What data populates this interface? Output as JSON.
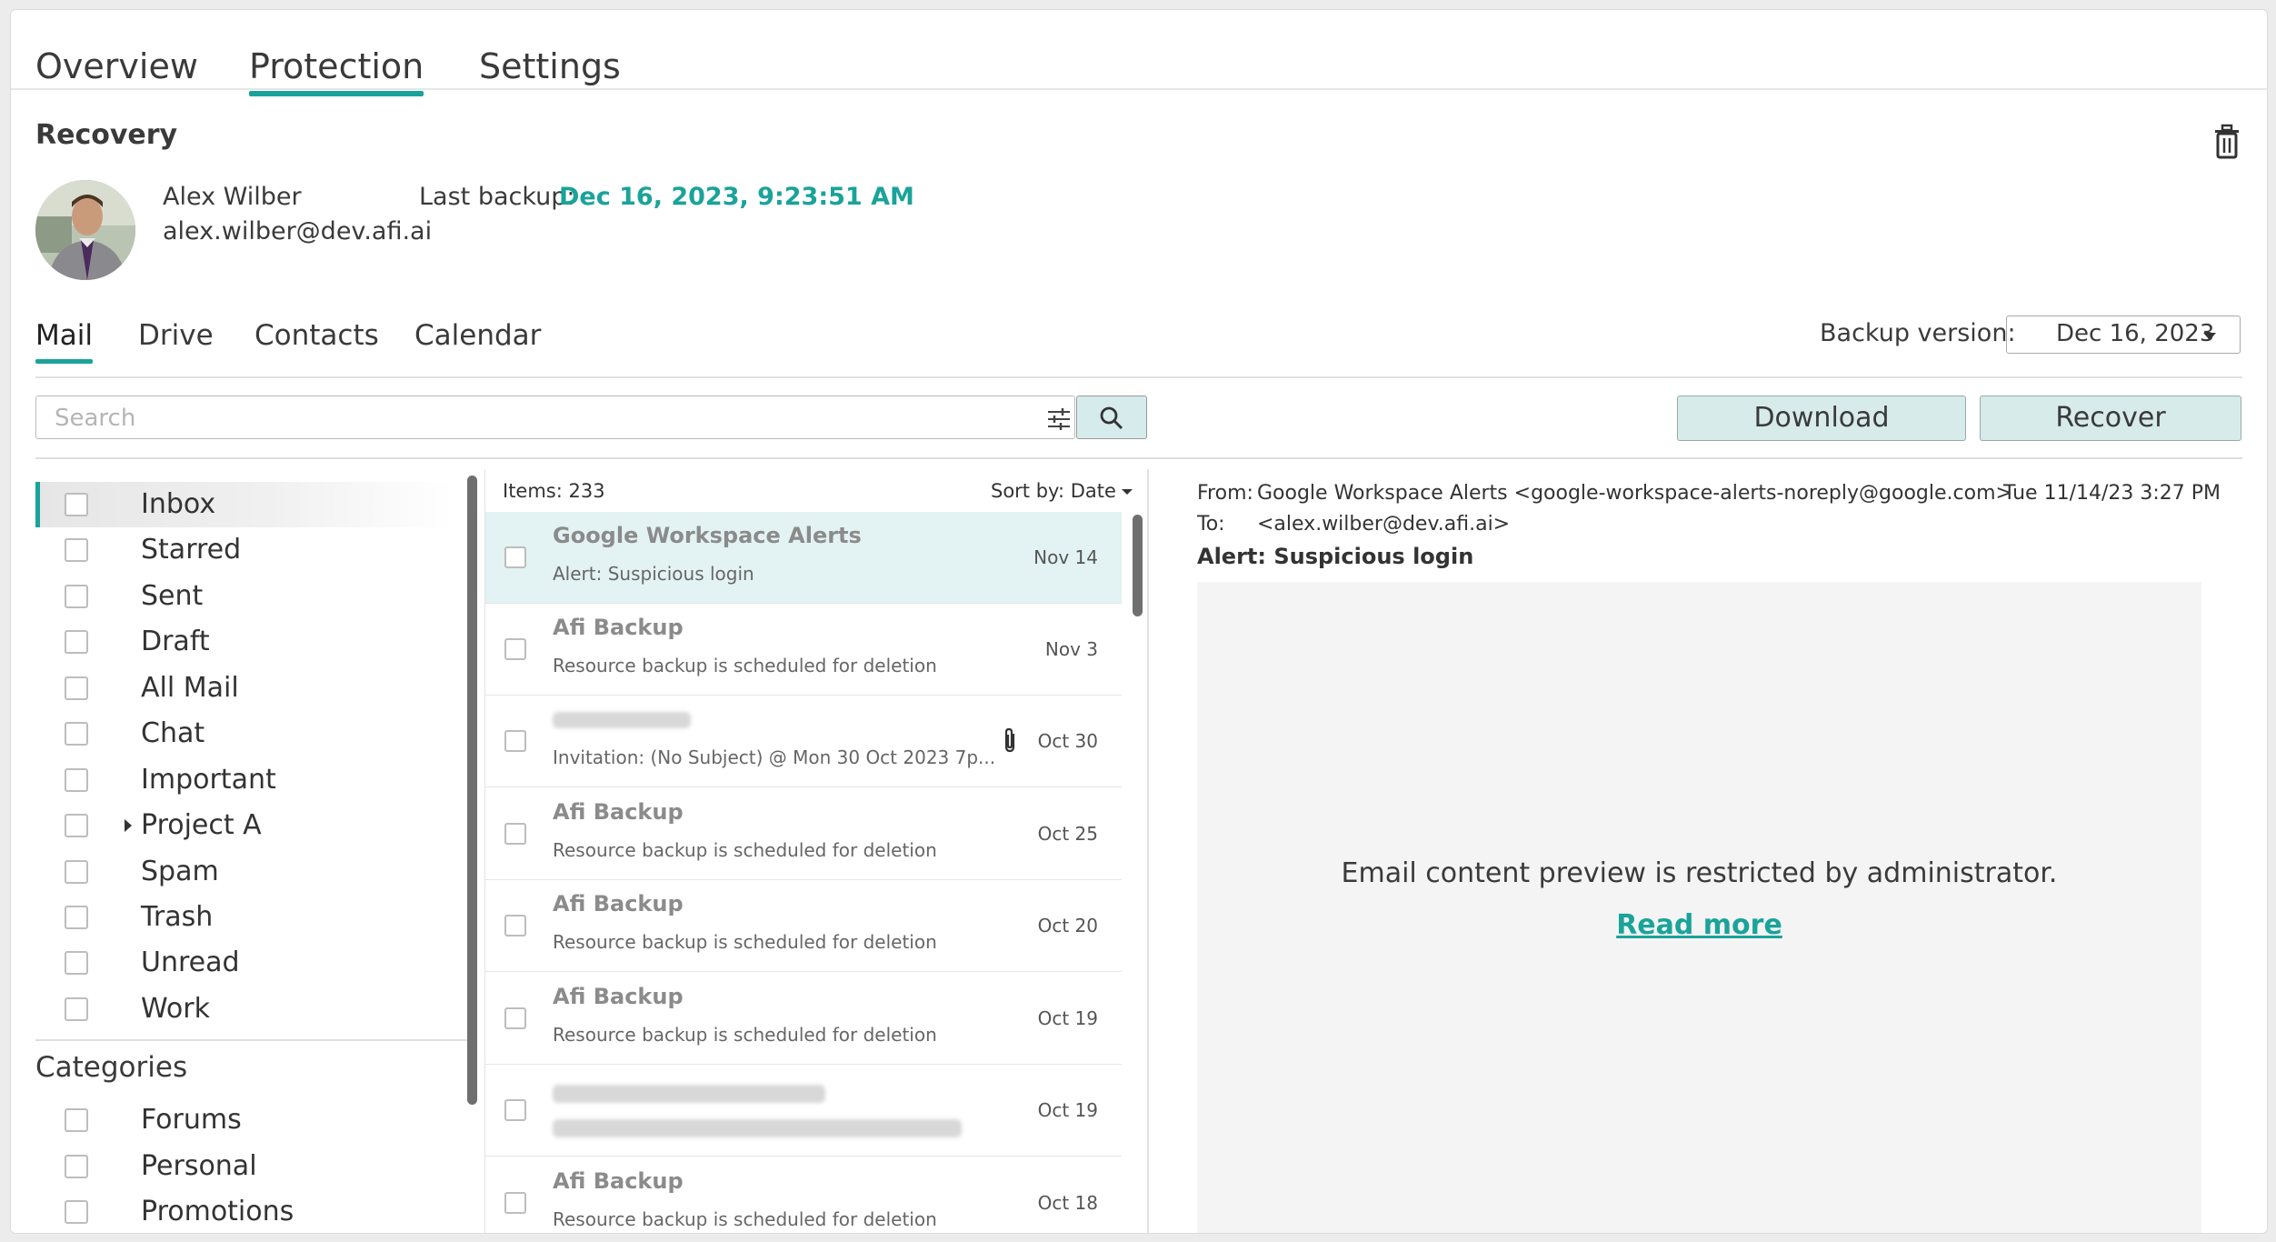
{
  "top_tabs": [
    "Overview",
    "Protection",
    "Settings"
  ],
  "section_title": "Recovery",
  "user": {
    "name": "Alex Wilber",
    "email": "alex.wilber@dev.afi.ai"
  },
  "last_backup": {
    "label": "Last backup:",
    "value": "Dec 16, 2023, 9:23:51 AM"
  },
  "sub_tabs": [
    "Mail",
    "Drive",
    "Contacts",
    "Calendar"
  ],
  "backup_version": {
    "label": "Backup version:",
    "value": "Dec 16, 2023"
  },
  "search": {
    "placeholder": "Search"
  },
  "actions": {
    "download": "Download",
    "recover": "Recover"
  },
  "folders": [
    "Inbox",
    "Starred",
    "Sent",
    "Draft",
    "All Mail",
    "Chat",
    "Important",
    "Project A",
    "Spam",
    "Trash",
    "Unread",
    "Work"
  ],
  "categories": {
    "title": "Categories",
    "items": [
      "Forums",
      "Personal",
      "Promotions"
    ]
  },
  "list": {
    "items_count": "Items: 233",
    "sort_label": "Sort by: Date",
    "messages": [
      {
        "sender": "Google Workspace Alerts",
        "subject": "Alert: Suspicious login",
        "date": "Nov 14"
      },
      {
        "sender": "Afi Backup",
        "subject": "Resource backup is scheduled for deletion",
        "date": "Nov 3"
      },
      {
        "sender": "",
        "subject": "Invitation: (No Subject) @ Mon 30 Oct 2023 7p...",
        "date": "Oct 30"
      },
      {
        "sender": "Afi Backup",
        "subject": "Resource backup is scheduled for deletion",
        "date": "Oct 25"
      },
      {
        "sender": "Afi Backup",
        "subject": "Resource backup is scheduled for deletion",
        "date": "Oct 20"
      },
      {
        "sender": "Afi Backup",
        "subject": "Resource backup is scheduled for deletion",
        "date": "Oct 19"
      },
      {
        "sender": "",
        "subject": "",
        "date": "Oct 19"
      },
      {
        "sender": "Afi Backup",
        "subject": "Resource backup is scheduled for deletion",
        "date": "Oct 18"
      }
    ]
  },
  "preview": {
    "from_label": "From:",
    "from": "Google Workspace Alerts <google-workspace-alerts-noreply@google.com>",
    "date": "Tue 11/14/23 3:27 PM",
    "to_label": "To:",
    "to": "<alex.wilber@dev.afi.ai>",
    "subject": "Alert: Suspicious login",
    "restricted_text": "Email content preview is restricted by administrator.",
    "read_more": "Read more"
  },
  "colors": {
    "accent": "#1aa39a",
    "button_bg": "#d7ebea",
    "selected_row": "#e3f2f2"
  }
}
